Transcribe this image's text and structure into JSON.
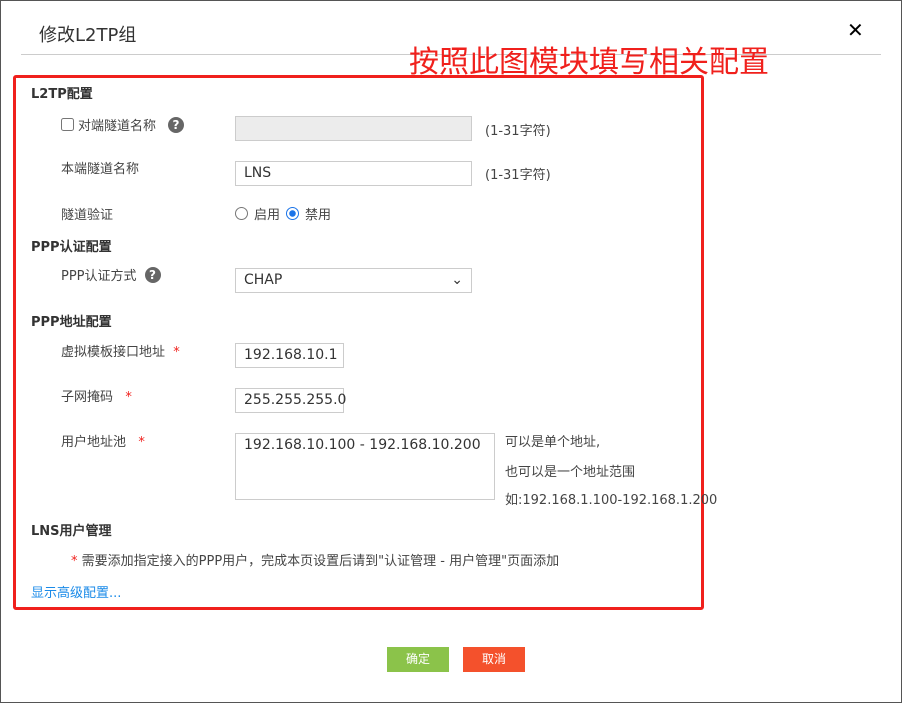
{
  "dialog": {
    "title": "修改L2TP组",
    "close_icon": "close-icon"
  },
  "annotation": "按照此图模块填写相关配置",
  "l2tp": {
    "section": "L2TP配置",
    "peer_tunnel_label": "对端隧道名称",
    "peer_tunnel_checked": false,
    "peer_tunnel_value": "",
    "peer_hint": "(1-31字符)",
    "local_tunnel_label": "本端隧道名称",
    "local_tunnel_value": "LNS",
    "local_hint": "(1-31字符)",
    "auth_label": "隧道验证",
    "enable": "启用",
    "disable": "禁用",
    "selected": "禁用"
  },
  "ppp_auth": {
    "section": "PPP认证配置",
    "method_label": "PPP认证方式",
    "method_value": "CHAP"
  },
  "ppp_addr": {
    "section": "PPP地址配置",
    "vt_label": "虚拟模板接口地址",
    "vt_value": "192.168.10.1",
    "mask_label": "子网掩码",
    "mask_value": "255.255.255.0",
    "pool_label": "用户地址池",
    "pool_value": "192.168.10.100 - 192.168.10.200",
    "hint1": "可以是单个地址,",
    "hint2": "也可以是一个地址范围",
    "hint3": "如:192.168.1.100-192.168.1.200"
  },
  "lns": {
    "section": "LNS用户管理",
    "note": "需要添加指定接入的PPP用户，完成本页设置后请到\"认证管理 - 用户管理\"页面添加",
    "advanced_link": "显示高级配置..."
  },
  "buttons": {
    "ok": "确定",
    "cancel": "取消"
  },
  "colors": {
    "ok": "#8bc34a",
    "cancel": "#f4512c",
    "annotation": "#f0201c"
  }
}
